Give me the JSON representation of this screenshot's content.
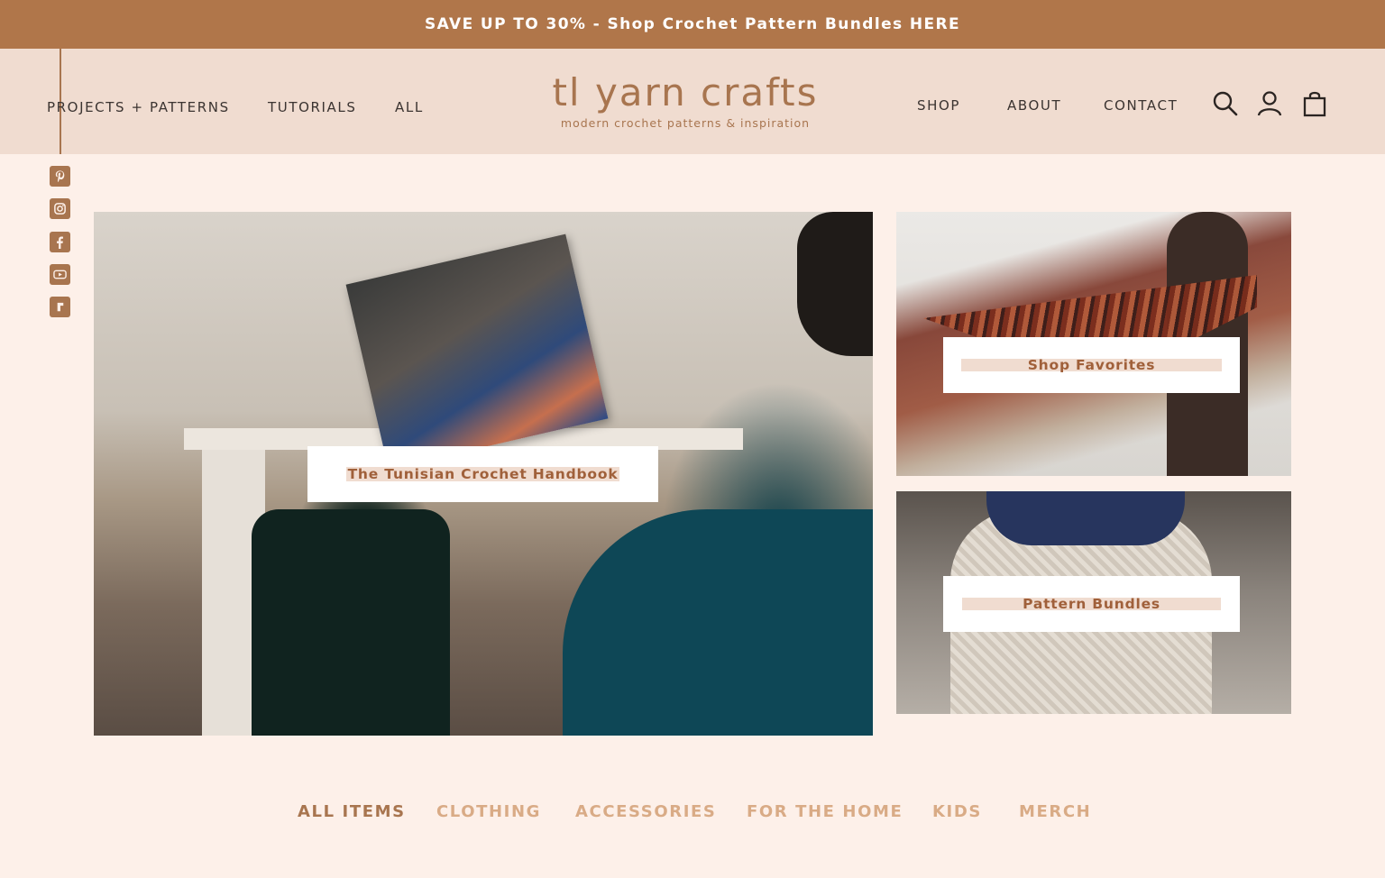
{
  "promo_banner": {
    "text": "SAVE UP TO 30% - Shop Crochet Pattern Bundles HERE"
  },
  "header": {
    "nav_left": [
      "PROJECTS + PATTERNS",
      "TUTORIALS",
      "ALL"
    ],
    "logo": {
      "title": "tl yarn crafts",
      "tagline": "modern crochet patterns & inspiration"
    },
    "nav_right": [
      "SHOP",
      "ABOUT",
      "CONTACT"
    ],
    "icons": [
      "search-icon",
      "account-icon",
      "cart-icon"
    ]
  },
  "social": [
    "pinterest-icon",
    "instagram-icon",
    "facebook-icon",
    "youtube-icon",
    "ravelry-icon"
  ],
  "features": {
    "hero_label": "The Tunisian Crochet Handbook",
    "favorites_label": "Shop Favorites",
    "bundles_label": "Pattern Bundles"
  },
  "categories": [
    "ALL ITEMS",
    "CLOTHING",
    "ACCESSORIES",
    "FOR THE HOME",
    "KIDS",
    "MERCH"
  ],
  "active_category": "ALL ITEMS",
  "colors": {
    "brand": "#a8754f",
    "banner": "#b0764a",
    "header_bg": "#f0dcd0",
    "page_bg": "#fdf0e9",
    "category_inactive": "#d9ab86"
  }
}
